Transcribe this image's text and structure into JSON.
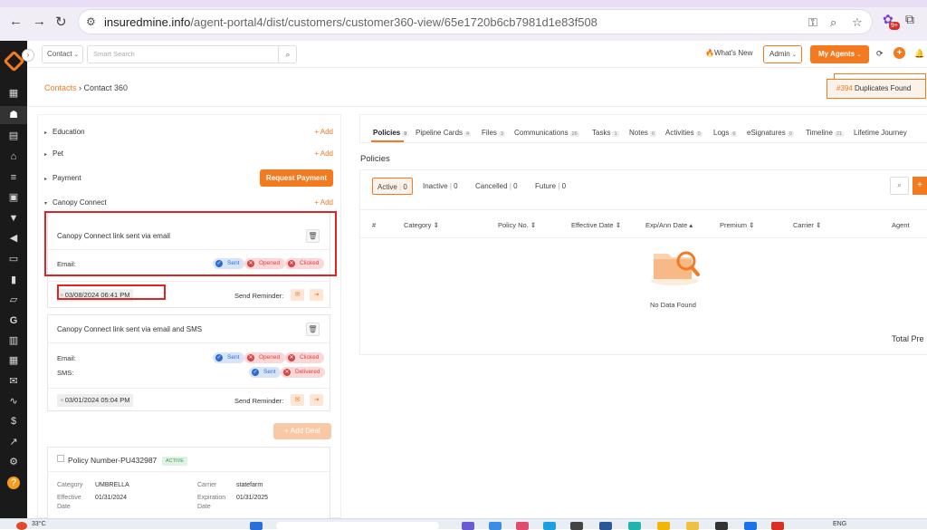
{
  "browser": {
    "url_host": "insuredmine.info",
    "url_path": "/agent-portal4/dist/customers/customer360-view/65e1720b6cb7981d1e83f508",
    "ext_badge": "9+"
  },
  "header": {
    "contact_type": "Contact",
    "search_placeholder": "Smart Search",
    "whats_new": "What's New",
    "role": "Admin",
    "my_agents": "My Agents"
  },
  "breadcrumb": {
    "root": "Contacts",
    "sep": " › ",
    "current": "Contact 360"
  },
  "duplicates": {
    "count": "#394",
    "label": "Duplicates Found"
  },
  "left": {
    "sections": [
      {
        "label": "Education",
        "add": "+ Add"
      },
      {
        "label": "Pet",
        "add": "+ Add"
      },
      {
        "label": "Payment",
        "button": "Request Payment"
      },
      {
        "label": "Canopy Connect",
        "add": "+ Add"
      }
    ],
    "canopy_cards": [
      {
        "title": "Canopy Connect link sent via email",
        "email_label": "Email:",
        "email_status": [
          "Sent",
          "Opened",
          "Clicked"
        ],
        "date": "03/08/2024 06:41 PM",
        "reminder": "Send Reminder:"
      },
      {
        "title": "Canopy Connect link sent via email and SMS",
        "email_label": "Email:",
        "email_status": [
          "Sent",
          "Opened",
          "Clicked"
        ],
        "sms_label": "SMS:",
        "sms_status": [
          "Sent",
          "Delivered"
        ],
        "date": "03/01/2024 05:04 PM",
        "reminder": "Send Reminder:"
      }
    ],
    "add_deal": "+ Add Deal",
    "policy": {
      "title": "Policy Number-PU432987",
      "badge": "ACTIVE",
      "category_label": "Category",
      "category": "UMBRELLA",
      "carrier_label": "Carrier",
      "carrier": "statefarm",
      "effective_label": "Effective",
      "effective_label2": "Date",
      "effective": "01/31/2024",
      "expiration_label": "Expiration",
      "expiration_label2": "Date",
      "expiration": "01/31/2025"
    }
  },
  "tabs": [
    {
      "label": "Policies",
      "count": "0"
    },
    {
      "label": "Pipeline Cards",
      "count": "4"
    },
    {
      "label": "Files",
      "count": "3"
    },
    {
      "label": "Communications",
      "count": "26"
    },
    {
      "label": "Tasks",
      "count": "1"
    },
    {
      "label": "Notes",
      "count": "0"
    },
    {
      "label": "Activities",
      "count": "0"
    },
    {
      "label": "Logs",
      "count": "6"
    },
    {
      "label": "eSignatures",
      "count": "0"
    },
    {
      "label": "Timeline",
      "count": "21"
    },
    {
      "label": "Lifetime Journey",
      "count": ""
    }
  ],
  "policies": {
    "title": "Policies",
    "status_tabs": [
      {
        "label": "Active",
        "count": "0"
      },
      {
        "label": "Inactive",
        "count": "0"
      },
      {
        "label": "Cancelled",
        "count": "0"
      },
      {
        "label": "Future",
        "count": "0"
      }
    ],
    "columns": [
      "#",
      "Category ⇕",
      "Policy No. ⇕",
      "Effective Date ⇕",
      "Exp/Ann Date ▴",
      "Premium ⇕",
      "Carrier ⇕",
      "Agent"
    ],
    "empty": "No Data Found",
    "total": "Total Pre"
  },
  "taskbar": {
    "temp": "33°C",
    "lang": "ENG"
  },
  "colors": {
    "accent": "#f47a20",
    "highlight": "#e02424",
    "sidebar": "#1a1a1a"
  }
}
